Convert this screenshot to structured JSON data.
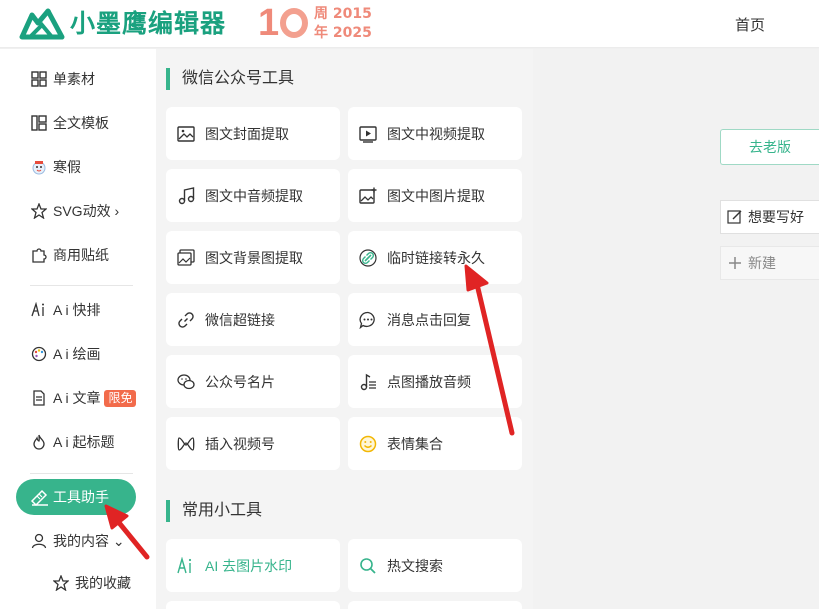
{
  "header": {
    "brand": "小墨鹰编辑器",
    "anniversary_number": "1",
    "anniversary_line1": "周 2015",
    "anniversary_line2": "年 2025",
    "nav_home": "首页"
  },
  "sidebar": {
    "items": [
      {
        "label": "单素材",
        "icon": "grid-icon"
      },
      {
        "label": "全文模板",
        "icon": "layout-icon"
      },
      {
        "label": "寒假",
        "icon": "snowman-icon"
      },
      {
        "label": "SVG动效 ›",
        "icon": "star-icon"
      },
      {
        "label": "商用贴纸",
        "icon": "puzzle-icon"
      },
      {
        "label": "A i 快排",
        "icon": "ai-icon"
      },
      {
        "label": "A i 绘画",
        "icon": "palette-icon"
      },
      {
        "label": "A i 文章",
        "icon": "doc-icon",
        "badge": "限免"
      },
      {
        "label": "A i 起标题",
        "icon": "flame-icon"
      },
      {
        "label": "工具助手",
        "icon": "tool-icon",
        "active": true
      },
      {
        "label": "我的内容 ⌄",
        "icon": "user-icon"
      },
      {
        "label": "我的收藏",
        "icon": "star-outline-icon"
      }
    ]
  },
  "panel": {
    "section1_title": "微信公众号工具",
    "section2_title": "常用小工具",
    "tools": [
      {
        "label": "图文封面提取",
        "icon": "image-icon"
      },
      {
        "label": "图文中视频提取",
        "icon": "video-icon"
      },
      {
        "label": "图文中音频提取",
        "icon": "music-icon"
      },
      {
        "label": "图文中图片提取",
        "icon": "image-plus-icon"
      },
      {
        "label": "图文背景图提取",
        "icon": "images-icon"
      },
      {
        "label": "临时链接转永久",
        "icon": "link-green-icon"
      },
      {
        "label": "微信超链接",
        "icon": "link-icon"
      },
      {
        "label": "消息点击回复",
        "icon": "chat-icon"
      },
      {
        "label": "公众号名片",
        "icon": "wechat-icon"
      },
      {
        "label": "点图播放音频",
        "icon": "music-list-icon"
      },
      {
        "label": "插入视频号",
        "icon": "channels-icon"
      },
      {
        "label": "表情集合",
        "icon": "smile-icon"
      }
    ],
    "common_tools": [
      {
        "label": "AI 去图片水印",
        "icon": "ai-green-icon"
      },
      {
        "label": "热文搜索",
        "icon": "search-icon"
      }
    ]
  },
  "right": {
    "old_version": "去老版",
    "wish": "想要写好",
    "new": "新建"
  },
  "colors": {
    "brand": "#1aa17f",
    "accent": "#37b48c",
    "badge": "#f26b4b",
    "arrow": "#e02424"
  }
}
